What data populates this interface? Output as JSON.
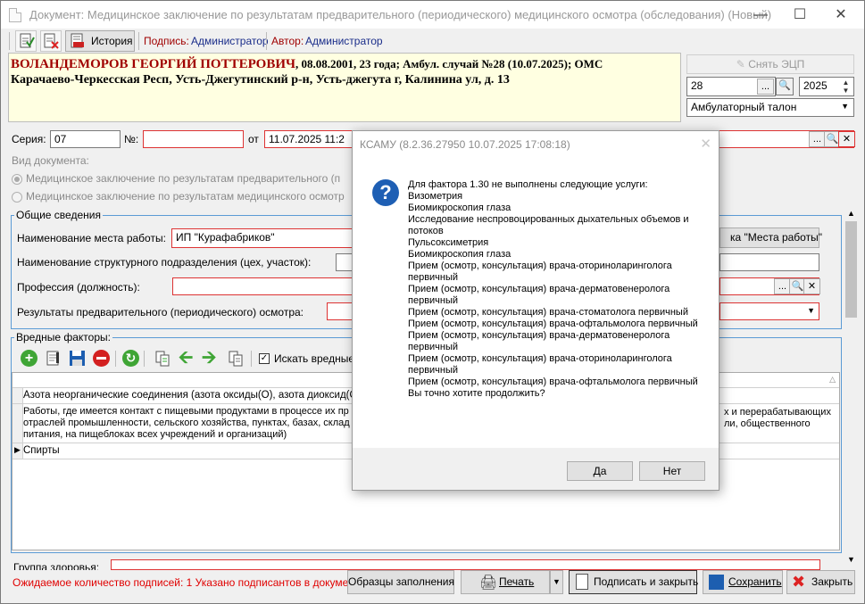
{
  "window": {
    "title": "Документ: Медицинское заключение по результатам предварительного (периодического) медицинского осмотра (обследования) (Новый)"
  },
  "toolbar": {
    "history_label": "История",
    "sign_label": "Подпись:",
    "sign_value": "Администратор",
    "author_label": "Автор:",
    "author_value": "Администратор"
  },
  "patient": {
    "name": "ВОЛАНДЕМОРОВ ГЕОРГИЙ ПОТТЕРОВИЧ",
    "details": ", 08.08.2001, 23 года; Амбул. случай №28 (10.07.2025); ОМС",
    "address": "Карачаево-Черкесская Респ, Усть-Джегутинский р-н, Усть-джегута г, Калинина ул, д. 13"
  },
  "right_panel": {
    "remove_sign_label": "Снять ЭЦП",
    "case_number": "28",
    "year": "2025",
    "doc_type": "Амбулаторный талон"
  },
  "series": {
    "series_label": "Серия:",
    "series_value": "07",
    "number_label": "№:",
    "number_value": "",
    "from_label": "от",
    "date_value": "11.07.2025 11:2"
  },
  "doc_type_section": {
    "label": "Вид документа:",
    "option1": "Медицинское заключение по результатам предварительного (п",
    "option2": "Медицинское заключение по результатам медицинского осмотр"
  },
  "general": {
    "title": "Общие сведения",
    "workplace_label": "Наименование места работы:",
    "workplace_value": "ИП \"Курафабриков\"",
    "workplace_button": "ка \"Места работы\"",
    "subdivision_label": "Наименование структурного подразделения (цех, участок):",
    "profession_label": "Профессия (должность):",
    "results_label": "Результаты предварительного (периодического) осмотра:"
  },
  "hazards": {
    "title": "Вредные факторы:",
    "search_label": "Искать вредные",
    "rows": [
      "Азота неорганические соединения (азота оксиды(О), азота диоксид(О)",
      "Работы, где имеется контакт с пищевыми продуктами в процессе их пр",
      "отраслей промышленности, сельского хозяйства, пунктах, базах, склад",
      "питания, на пищеблоках всех учреждений и организаций)",
      "Спирты"
    ],
    "row2_right1": "х и перерабатывающих",
    "row2_right2": "ли, общественного"
  },
  "bottom": {
    "health_group_label": "Группа здоровья:",
    "status_text": "Ожидаемое количество подписей: 1 Указано подписантов в документе: 0",
    "samples_button": "Образцы заполнения",
    "print_button": "Печать",
    "sign_close_button": "Подписать и закрыть",
    "save_button": "Сохранить",
    "close_button": "Закрыть"
  },
  "dialog": {
    "title": "КСАМУ (8.2.36.27950 10.07.2025 17:08:18)",
    "lines": [
      "Для фактора 1.30 не выполнены следующие услуги:",
      "Визометрия",
      "Биомикроскопия глаза",
      "Исследование неспровоцированных дыхательных объемов и потоков",
      "Пульсоксиметрия",
      "Биомикроскопия глаза",
      "Прием (осмотр, консультация) врача-оториноларинголога первичный",
      "Прием (осмотр, консультация) врача-дерматовенеролога первичный",
      "Прием (осмотр, консультация) врача-стоматолога первичный",
      "Прием (осмотр, консультация) врача-офтальмолога первичный",
      "Прием (осмотр, консультация) врача-дерматовенеролога первичный",
      "Прием (осмотр, консультация) врача-оториноларинголога первичный",
      "Прием (осмотр, консультация) врача-офтальмолога первичный",
      "Вы точно хотите продолжить?"
    ],
    "yes_label": "Да",
    "no_label": "Нет"
  }
}
